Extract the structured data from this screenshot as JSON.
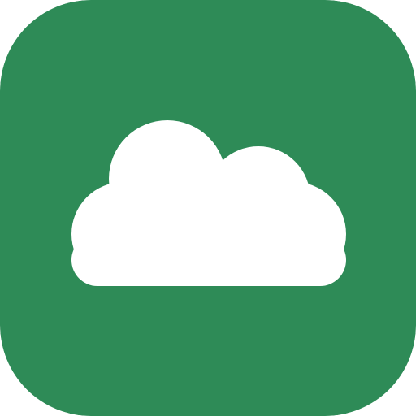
{
  "app_icon": {
    "icon": "cloud-icon",
    "background_color": "#2E8B57",
    "glyph_color": "#FFFFFF"
  }
}
